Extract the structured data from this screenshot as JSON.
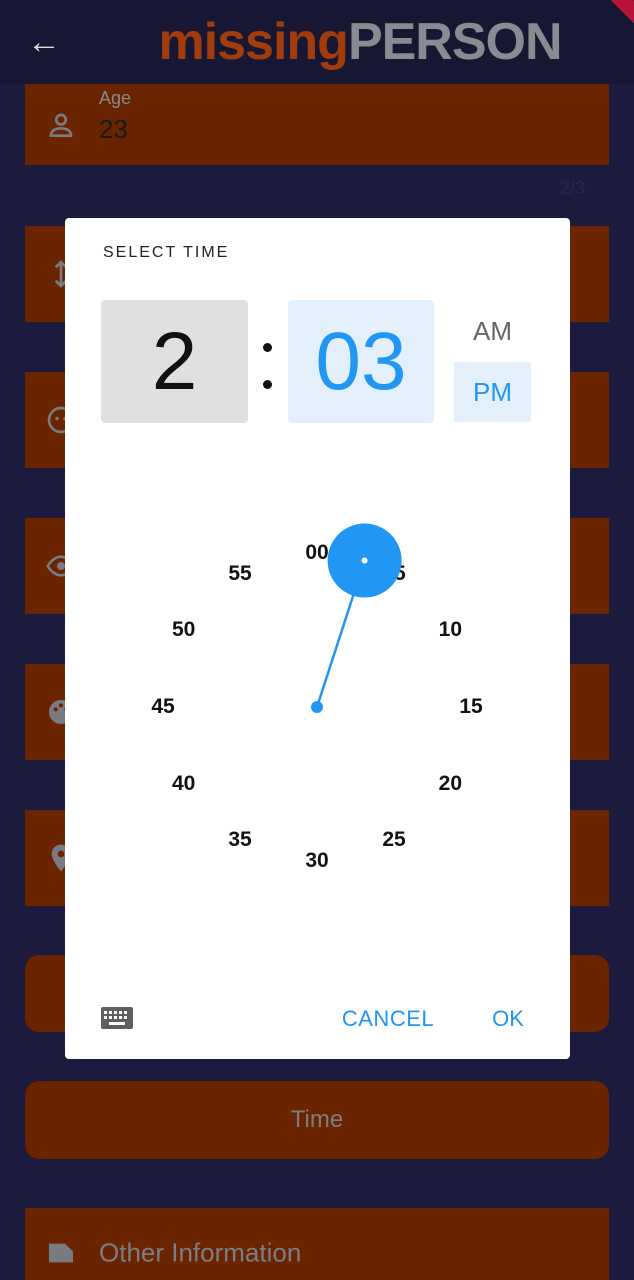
{
  "app_bar": {
    "title_part1": "missing",
    "title_part2": "PERSON"
  },
  "form": {
    "age": {
      "label": "Age",
      "value": "23"
    },
    "counter": "2/3",
    "time_button_label": "Time",
    "other_info_label": "Other Information"
  },
  "time_picker": {
    "title": "SELECT TIME",
    "hour": "2",
    "minute": "03",
    "am_label": "AM",
    "pm_label": "PM",
    "selected_period": "PM",
    "dial_numbers": [
      "00",
      "05",
      "10",
      "15",
      "20",
      "25",
      "30",
      "35",
      "40",
      "45",
      "50",
      "55"
    ],
    "selected_minute": 3,
    "cancel_label": "CANCEL",
    "ok_label": "OK"
  },
  "colors": {
    "accent": "#2196f3",
    "field_bg": "#6a2400",
    "page_bg": "#1c1a3d"
  }
}
